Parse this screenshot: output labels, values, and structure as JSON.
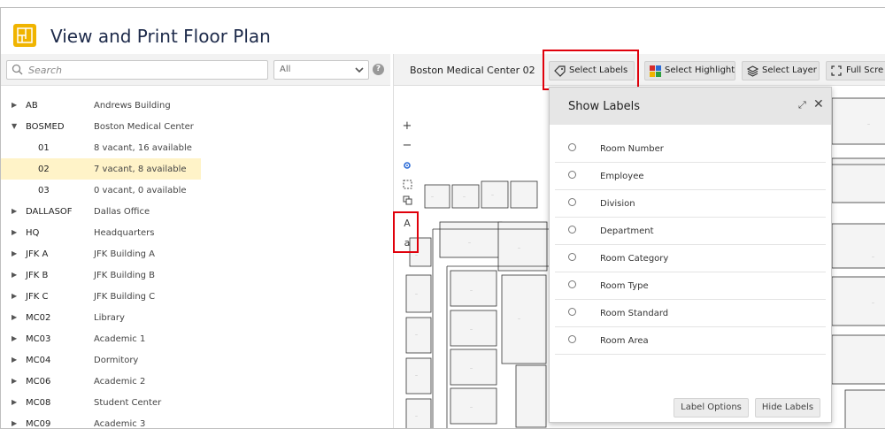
{
  "header": {
    "title": "View and Print Floor Plan",
    "icon": "floorplan-icon",
    "icon_color": "#f0b400"
  },
  "search": {
    "placeholder": "Search",
    "filter_value": "All"
  },
  "tree": [
    {
      "code": "AB",
      "desc": "Andrews Building",
      "expanded": false
    },
    {
      "code": "BOSMED",
      "desc": "Boston Medical Center",
      "expanded": true
    },
    {
      "code": "01",
      "desc": "8 vacant, 16 available",
      "child": true
    },
    {
      "code": "02",
      "desc": "7 vacant, 8 available",
      "child": true,
      "selected": true
    },
    {
      "code": "03",
      "desc": "0 vacant, 0 available",
      "child": true
    },
    {
      "code": "DALLASOF",
      "desc": "Dallas Office",
      "expanded": false
    },
    {
      "code": "HQ",
      "desc": "Headquarters",
      "expanded": false
    },
    {
      "code": "JFK A",
      "desc": "JFK Building A",
      "expanded": false
    },
    {
      "code": "JFK B",
      "desc": "JFK Building B",
      "expanded": false
    },
    {
      "code": "JFK C",
      "desc": "JFK Building C",
      "expanded": false
    },
    {
      "code": "MC02",
      "desc": "Library",
      "expanded": false
    },
    {
      "code": "MC03",
      "desc": "Academic 1",
      "expanded": false
    },
    {
      "code": "MC04",
      "desc": "Dormitory",
      "expanded": false
    },
    {
      "code": "MC06",
      "desc": "Academic 2",
      "expanded": false
    },
    {
      "code": "MC08",
      "desc": "Student Center",
      "expanded": false
    },
    {
      "code": "MC09",
      "desc": "Academic 3",
      "expanded": false
    }
  ],
  "toolbar": {
    "building_floor": "Boston Medical Center 02",
    "select_labels": "Select Labels",
    "select_highlight": "Select Highlight",
    "select_layer": "Select Layer",
    "full_screen": "Full Scre"
  },
  "map_tools": {
    "zoom_in": "+",
    "zoom_out": "−",
    "text_larger": "A",
    "text_smaller": "a"
  },
  "show_labels": {
    "title": "Show Labels",
    "options": [
      "Room Number",
      "Employee",
      "Division",
      "Department",
      "Room Category",
      "Room Type",
      "Room Standard",
      "Room Area"
    ],
    "label_options": "Label Options",
    "hide_labels": "Hide Labels"
  },
  "colors": {
    "highlight_box": "#e0000b",
    "selected_row": "#fff3c8"
  }
}
